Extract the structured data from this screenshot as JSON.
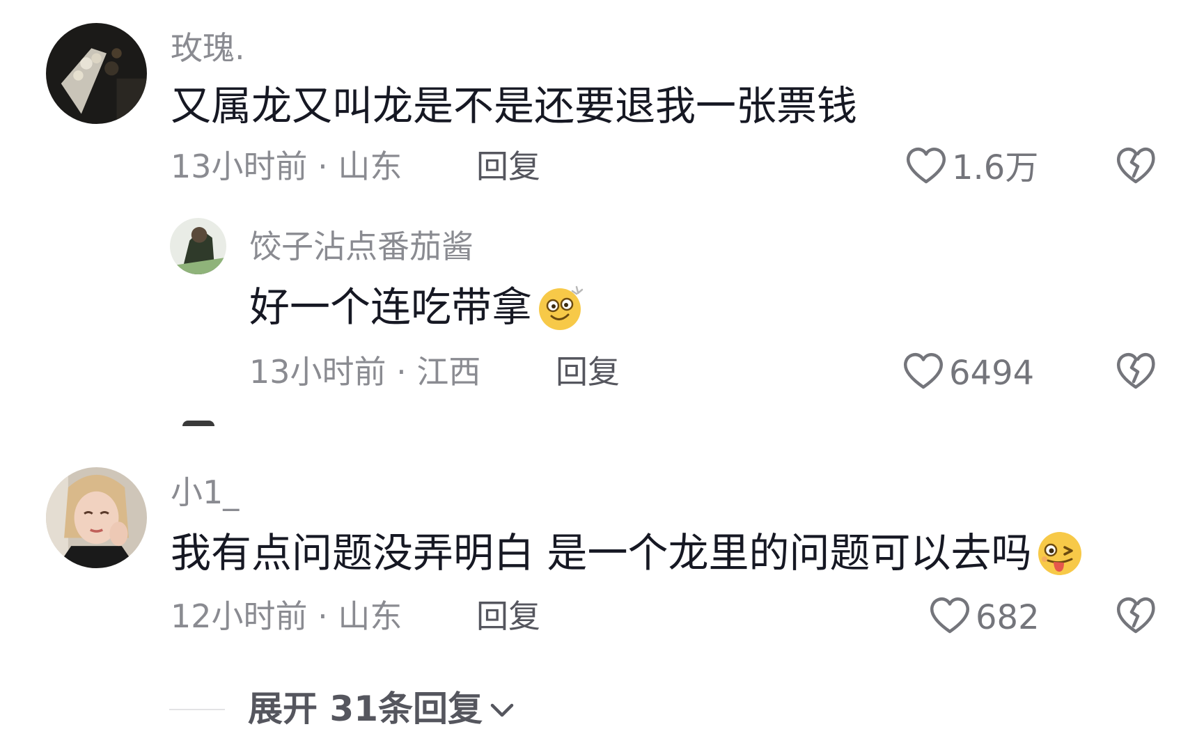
{
  "comments": [
    {
      "username": "玫瑰.",
      "text": "又属龙又叫龙是不是还要退我一张票钱",
      "meta": "13小时前 · 山东",
      "reply_label": "回复",
      "likes": "1.6万"
    },
    {
      "username": "饺子沾点番茄酱",
      "text": "好一个连吃带拿",
      "emoji": "dizzy-smile-emoji",
      "meta": "13小时前 · 江西",
      "reply_label": "回复",
      "likes": "6494"
    },
    {
      "username": "小1_",
      "text": "我有点问题没弄明白 是一个龙里的问题可以去吗",
      "emoji": "tongue-wink-emoji",
      "meta": "12小时前 · 山东",
      "reply_label": "回复",
      "likes": "682"
    }
  ],
  "expand": {
    "label": "展开 31条回复"
  },
  "icons": {
    "like": "heart-outline-icon",
    "dislike": "broken-heart-icon",
    "chevron": "chevron-down-icon"
  },
  "colors": {
    "text": "#161823",
    "muted": "#8a8b91",
    "icon": "#74757b"
  }
}
